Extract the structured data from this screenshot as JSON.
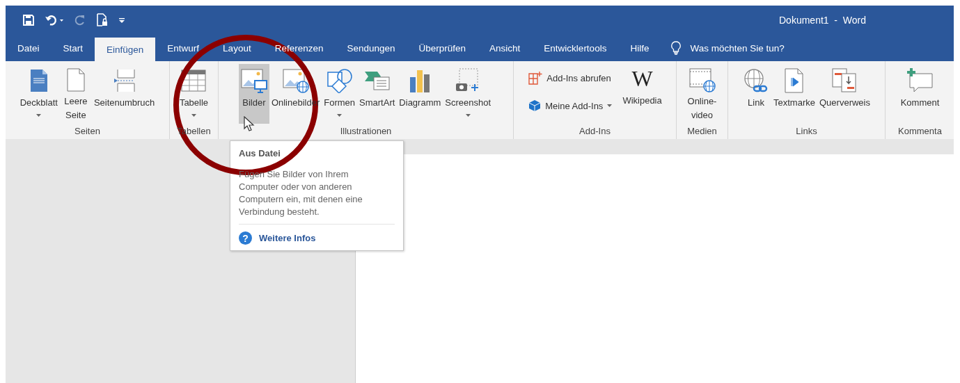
{
  "window": {
    "title": "Dokument1  -  Word"
  },
  "quick_access": [
    {
      "kind": "save",
      "disabled": false
    },
    {
      "kind": "undo",
      "disabled": false
    },
    {
      "kind": "redo",
      "disabled": true
    },
    {
      "kind": "touch",
      "disabled": false
    },
    {
      "kind": "customize",
      "disabled": false
    }
  ],
  "tabs": [
    {
      "label": "Datei",
      "selected": false
    },
    {
      "label": "Start",
      "selected": false
    },
    {
      "label": "Einfügen",
      "selected": true
    },
    {
      "label": "Entwurf",
      "selected": false
    },
    {
      "label": "Layout",
      "selected": false
    },
    {
      "label": "Referenzen",
      "selected": false
    },
    {
      "label": "Sendungen",
      "selected": false
    },
    {
      "label": "Überprüfen",
      "selected": false
    },
    {
      "label": "Ansicht",
      "selected": false
    },
    {
      "label": "Entwicklertools",
      "selected": false
    },
    {
      "label": "Hilfe",
      "selected": false
    }
  ],
  "tell_me": {
    "placeholder": "Was möchten Sie tun?"
  },
  "ribbon": {
    "groups": [
      {
        "label": "Seiten",
        "items": [
          {
            "kind": "large",
            "label": "Deckblatt",
            "dropdown": true,
            "hovered": false
          },
          {
            "kind": "large",
            "label": "Leere Seite",
            "dropdown": false,
            "hovered": false
          },
          {
            "kind": "large",
            "label": "Seitenumbruch",
            "dropdown": false,
            "hovered": false
          }
        ]
      },
      {
        "label": "Tabellen",
        "items": [
          {
            "kind": "large",
            "label": "Tabelle",
            "dropdown": true,
            "hovered": false
          }
        ]
      },
      {
        "label": "Illustrationen",
        "items": [
          {
            "kind": "large",
            "label": "Bilder",
            "dropdown": false,
            "hovered": true
          },
          {
            "kind": "large",
            "label": "Onlinebilder",
            "dropdown": false,
            "hovered": false
          },
          {
            "kind": "large",
            "label": "Formen",
            "dropdown": true,
            "hovered": false
          },
          {
            "kind": "large",
            "label": "SmartArt",
            "dropdown": false,
            "hovered": false
          },
          {
            "kind": "large",
            "label": "Diagramm",
            "dropdown": false,
            "hovered": false
          },
          {
            "kind": "large",
            "label": "Screenshot",
            "dropdown": true,
            "hovered": false
          }
        ]
      },
      {
        "label": "Add-Ins",
        "items": [
          {
            "kind": "small",
            "label": "Add-Ins abrufen",
            "dropdown": false,
            "hovered": false
          },
          {
            "kind": "small",
            "label": "Meine Add-Ins",
            "dropdown": true,
            "hovered": false
          },
          {
            "kind": "glyph",
            "glyph": "W",
            "label": "Wikipedia",
            "dropdown": false,
            "hovered": false
          }
        ]
      },
      {
        "label": "Medien",
        "items": [
          {
            "kind": "large",
            "label": "Online-video",
            "dropdown": false,
            "hovered": false
          }
        ]
      },
      {
        "label": "Links",
        "items": [
          {
            "kind": "large",
            "label": "Link",
            "dropdown": false,
            "hovered": false
          },
          {
            "kind": "large",
            "label": "Textmarke",
            "dropdown": false,
            "hovered": false
          },
          {
            "kind": "large",
            "label": "Querverweis",
            "dropdown": false,
            "hovered": false
          }
        ]
      },
      {
        "label": "Kommenta",
        "items": [
          {
            "kind": "large",
            "label": "Komment",
            "dropdown": false,
            "hovered": false
          }
        ]
      }
    ]
  },
  "tooltip": {
    "title": "Aus Datei",
    "text": "Fügen Sie Bilder von Ihrem Computer oder von anderen Computern ein, mit denen eine Verbindung besteht.",
    "link_icon": "?",
    "link": "Weitere Infos"
  }
}
